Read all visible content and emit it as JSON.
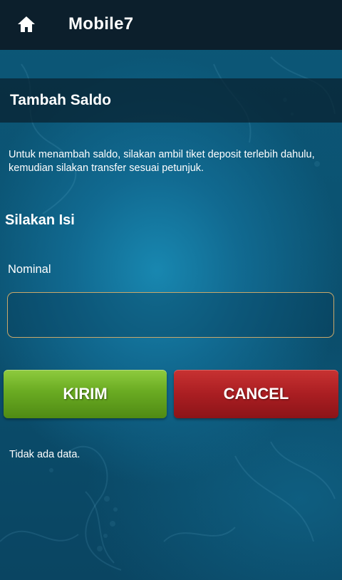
{
  "app": {
    "title": "Mobile7",
    "home_icon": "home-icon"
  },
  "page": {
    "title": "Tambah Saldo",
    "info": "Untuk menambah saldo, silakan ambil tiket deposit terlebih dahulu, kemudian silakan transfer sesuai petunjuk."
  },
  "form": {
    "heading": "Silakan Isi",
    "nominal_label": "Nominal",
    "nominal_value": "",
    "nominal_placeholder": ""
  },
  "buttons": {
    "submit_label": "KIRIM",
    "cancel_label": "CANCEL"
  },
  "results": {
    "empty_message": "Tidak ada data."
  },
  "colors": {
    "topbar": "#0c1f2c",
    "background": "#0b5271",
    "submit": "#6aab22",
    "cancel": "#aa1e22",
    "input_border": "#c9a86a"
  }
}
